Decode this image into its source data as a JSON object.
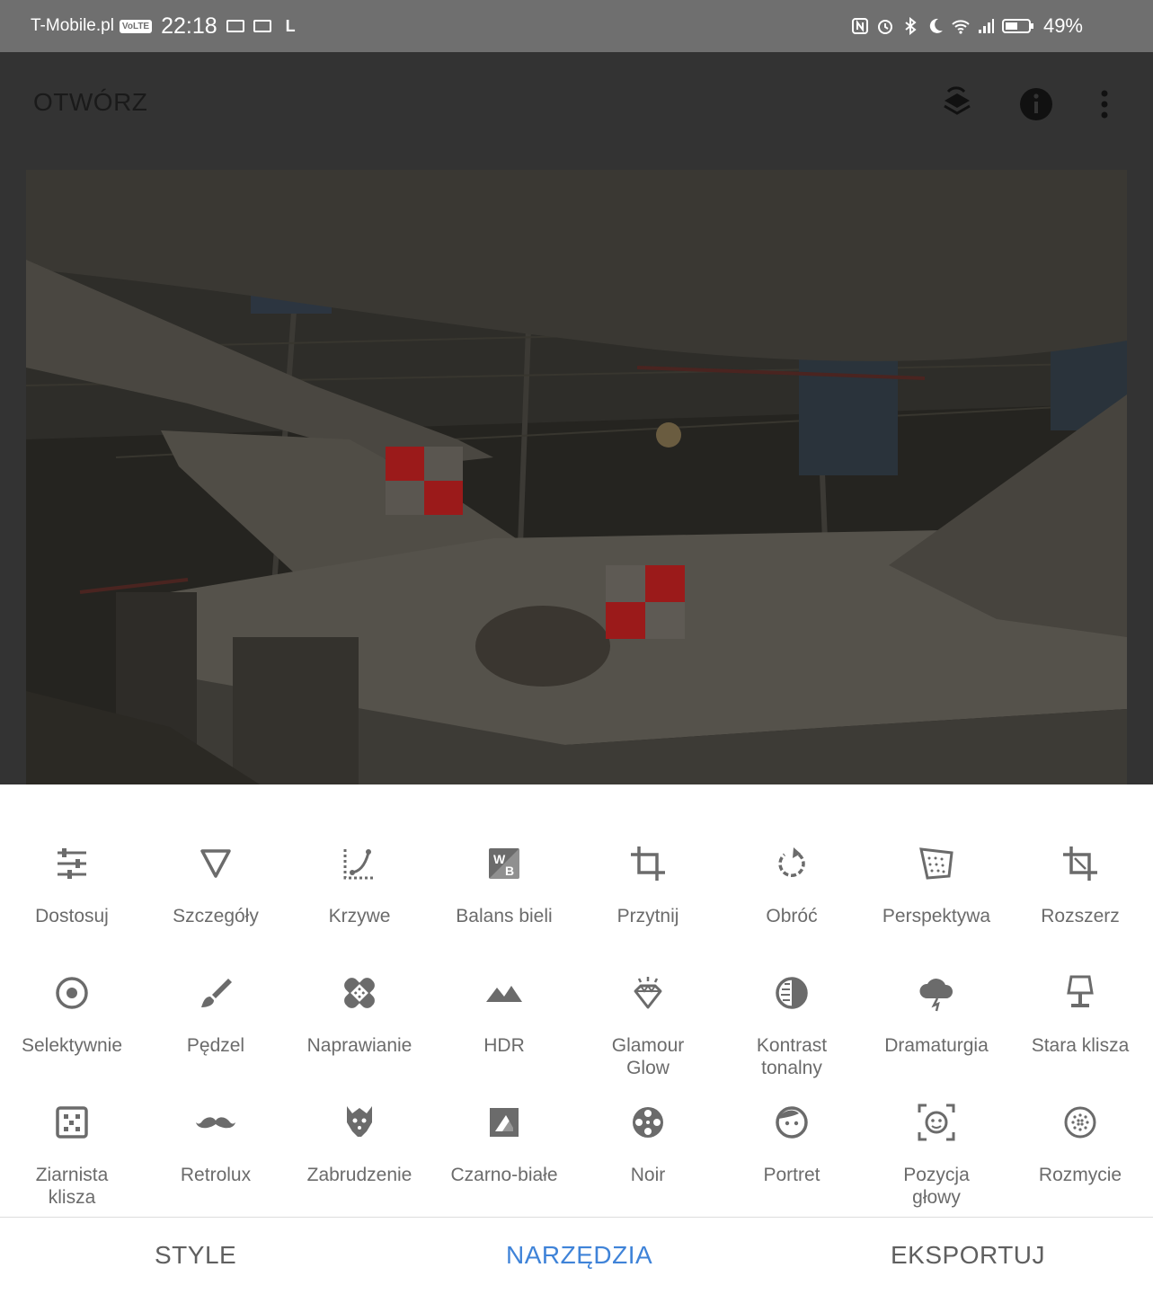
{
  "status_bar": {
    "carrier": "T-Mobile.pl",
    "volte": "VoLTE",
    "time": "22:18",
    "extra": "L",
    "battery": "49%"
  },
  "app_bar": {
    "open_label": "OTWÓRZ",
    "icons": [
      "layers-icon",
      "info-icon",
      "more-vert-icon"
    ]
  },
  "tools": [
    {
      "label": "Dostosuj",
      "icon": "tune-icon"
    },
    {
      "label": "Szczegóły",
      "icon": "details-triangle-icon"
    },
    {
      "label": "Krzywe",
      "icon": "curves-icon"
    },
    {
      "label": "Balans bieli",
      "icon": "white-balance-icon"
    },
    {
      "label": "Przytnij",
      "icon": "crop-icon"
    },
    {
      "label": "Obróć",
      "icon": "rotate-icon"
    },
    {
      "label": "Perspektywa",
      "icon": "perspective-icon"
    },
    {
      "label": "Rozszerz",
      "icon": "expand-icon"
    },
    {
      "label": "Selektywnie",
      "icon": "selective-icon"
    },
    {
      "label": "Pędzel",
      "icon": "brush-icon"
    },
    {
      "label": "Naprawianie",
      "icon": "healing-icon"
    },
    {
      "label": "HDR",
      "icon": "hdr-icon"
    },
    {
      "label": "Glamour\nGlow",
      "icon": "glamour-glow-icon"
    },
    {
      "label": "Kontrast\ntonalny",
      "icon": "tonal-contrast-icon"
    },
    {
      "label": "Dramaturgia",
      "icon": "drama-icon"
    },
    {
      "label": "Stara klisza",
      "icon": "vintage-lamp-icon"
    },
    {
      "label": "Ziarnista\nklisza",
      "icon": "grainy-film-icon"
    },
    {
      "label": "Retrolux",
      "icon": "mustache-icon"
    },
    {
      "label": "Zabrudzenie",
      "icon": "grunge-icon"
    },
    {
      "label": "Czarno-białe",
      "icon": "black-white-icon"
    },
    {
      "label": "Noir",
      "icon": "film-reel-icon"
    },
    {
      "label": "Portret",
      "icon": "portrait-face-icon"
    },
    {
      "label": "Pozycja\ngłowy",
      "icon": "head-pose-icon"
    },
    {
      "label": "Rozmycie",
      "icon": "blur-icon"
    }
  ],
  "bottom_nav": {
    "tabs": [
      "STYLE",
      "NARZĘDZIA",
      "EKSPORTUJ"
    ],
    "active": "NARZĘDZIA",
    "active_color": "#3f83d8"
  },
  "colors": {
    "status_bar": "#6f6f6f",
    "scrim": "#333333",
    "icon_gray": "#6b6b6b",
    "roundel_red": "#a01818"
  }
}
